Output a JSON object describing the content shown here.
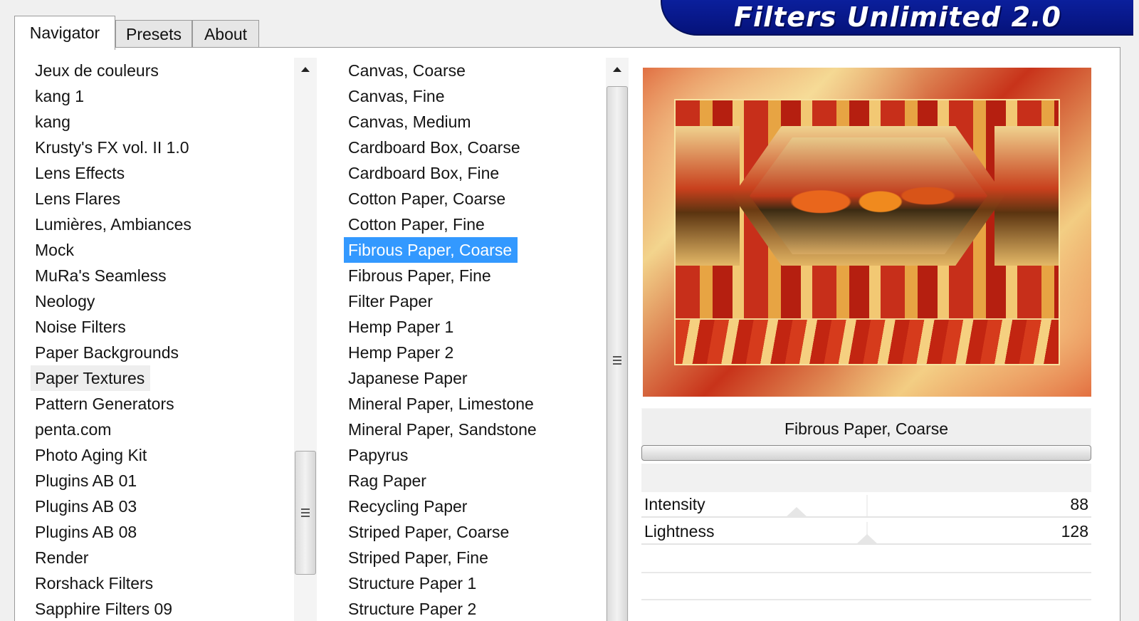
{
  "logo": {
    "text": "Filters Unlimited 2.0"
  },
  "tabs": [
    {
      "label": "Navigator",
      "active": true
    },
    {
      "label": "Presets",
      "active": false
    },
    {
      "label": "About",
      "active": false
    }
  ],
  "categories": {
    "items": [
      "Jeux de couleurs",
      "kang 1",
      "kang",
      "Krusty's FX vol. II 1.0",
      "Lens Effects",
      "Lens Flares",
      "Lumières, Ambiances",
      "Mock",
      "MuRa's Seamless",
      "Neology",
      "Noise Filters",
      "Paper Backgrounds",
      "Paper Textures",
      "Pattern Generators",
      "penta.com",
      "Photo Aging Kit",
      "Plugins AB 01",
      "Plugins AB 03",
      "Plugins AB 08",
      "Render",
      "Rorshack Filters",
      "Sapphire Filters 09"
    ],
    "hover_item": "Paper Textures",
    "scroll_thumb_label": "≡"
  },
  "filters": {
    "items": [
      "Canvas, Coarse",
      "Canvas, Fine",
      "Canvas, Medium",
      "Cardboard Box, Coarse",
      "Cardboard Box, Fine",
      "Cotton Paper, Coarse",
      "Cotton Paper, Fine",
      "Fibrous Paper, Coarse",
      "Fibrous Paper, Fine",
      "Filter Paper",
      "Hemp Paper 1",
      "Hemp Paper 2",
      "Japanese Paper",
      "Mineral Paper, Limestone",
      "Mineral Paper, Sandstone",
      "Papyrus",
      "Rag Paper",
      "Recycling Paper",
      "Striped Paper, Coarse",
      "Striped Paper, Fine",
      "Structure Paper 1",
      "Structure Paper 2"
    ],
    "selected_item": "Fibrous Paper, Coarse"
  },
  "selected_filter_name": "Fibrous Paper, Coarse",
  "parameters": [
    {
      "label": "Intensity",
      "value": "88",
      "fraction": 0.345
    },
    {
      "label": "Lightness",
      "value": "128",
      "fraction": 0.502
    }
  ]
}
